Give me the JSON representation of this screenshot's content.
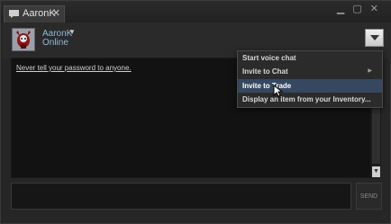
{
  "tab": {
    "label": "AaronK",
    "close_glyph": "✕",
    "icon": "chat-bubble-icon"
  },
  "window_controls": {
    "minimize": "▁",
    "maximize": "▢",
    "close": "✕"
  },
  "header": {
    "username": "AaronK",
    "dropdown_glyph": "▼",
    "status": "Online",
    "status_color": "#8fb8dc"
  },
  "chat": {
    "warning": "Never tell your password to anyone.",
    "scroll_down_glyph": "▼"
  },
  "input": {
    "placeholder": "",
    "send_label": "SEND"
  },
  "context_menu": {
    "items": [
      {
        "label": "Start voice chat",
        "has_submenu": false
      },
      {
        "label": "Invite to Chat",
        "has_submenu": true,
        "submenu_glyph": "▶"
      },
      {
        "label": "Invite to Trade",
        "has_submenu": false,
        "highlighted": true
      },
      {
        "label": "Display an item from your Inventory...",
        "has_submenu": false
      }
    ],
    "highlight_color": "#36485f"
  },
  "resize_grip_glyph": "⋰"
}
